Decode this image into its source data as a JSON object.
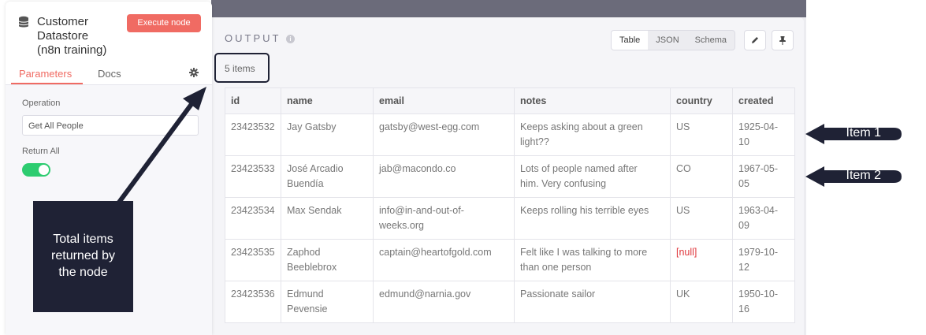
{
  "node": {
    "title_line1": "Customer",
    "title_line2": "Datastore",
    "title_line3": "(n8n training)",
    "execute_label": "Execute node",
    "tabs": {
      "parameters": "Parameters",
      "docs": "Docs"
    },
    "operation_label": "Operation",
    "operation_value": "Get All People",
    "return_all_label": "Return All",
    "return_all_on": true
  },
  "output": {
    "title": "OUTPUT",
    "views": [
      "Table",
      "JSON",
      "Schema"
    ],
    "active_view": "Table",
    "items_count": "5 items"
  },
  "table": {
    "columns": [
      "id",
      "name",
      "email",
      "notes",
      "country",
      "created"
    ],
    "rows": [
      {
        "id": "23423532",
        "name_l1": "Jay Gatsby",
        "name_l2": "",
        "email_l1": "gatsby@west-egg.com",
        "email_l2": "",
        "notes_l1": "Keeps asking about a green",
        "notes_l2": "light??",
        "country": "US",
        "created_l1": "1925-04-",
        "created_l2": "10"
      },
      {
        "id": "23423533",
        "name_l1": "José Arcadio",
        "name_l2": "Buendía",
        "email_l1": "jab@macondo.co",
        "email_l2": "",
        "notes_l1": "Lots of people named after",
        "notes_l2": "him. Very confusing",
        "country": "CO",
        "created_l1": "1967-05-",
        "created_l2": "05"
      },
      {
        "id": "23423534",
        "name_l1": "Max Sendak",
        "name_l2": "",
        "email_l1": "info@in-and-out-of-",
        "email_l2": "weeks.org",
        "notes_l1": "Keeps rolling his terrible eyes",
        "notes_l2": "",
        "country": "US",
        "created_l1": "1963-04-",
        "created_l2": "09"
      },
      {
        "id": "23423535",
        "name_l1": "Zaphod",
        "name_l2": "Beeblebrox",
        "email_l1": "captain@heartofgold.com",
        "email_l2": "",
        "notes_l1": "Felt like I was talking to more",
        "notes_l2": "than one person",
        "country": "[null]",
        "created_l1": "1979-10-",
        "created_l2": "12"
      },
      {
        "id": "23423536",
        "name_l1": "Edmund",
        "name_l2": "Pevensie",
        "email_l1": "edmund@narnia.gov",
        "email_l2": "",
        "notes_l1": "Passionate sailor",
        "notes_l2": "",
        "country": "UK",
        "created_l1": "1950-10-",
        "created_l2": "16"
      }
    ]
  },
  "callouts": {
    "total_line1": "Total items",
    "total_line2": "returned by",
    "total_line3": "the node",
    "item1": "Item 1",
    "item2": "Item 2"
  },
  "colors": {
    "accent": "#f06b63",
    "callout_bg": "#1f2235",
    "toggle_on": "#2dcc70",
    "null_value": "#e0393e"
  },
  "icons": [
    "database-icon",
    "gear-icon",
    "info-icon",
    "pencil-icon",
    "pin-icon",
    "chevron-down-icon"
  ]
}
